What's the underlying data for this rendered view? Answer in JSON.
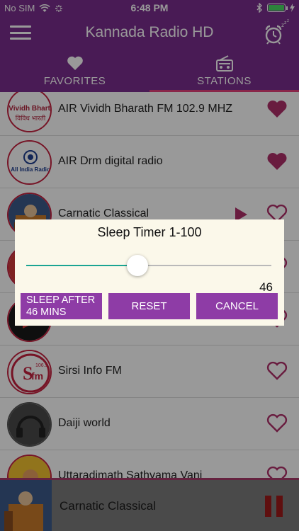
{
  "status_bar": {
    "carrier": "No SIM",
    "time": "6:48 PM"
  },
  "header": {
    "title": "Kannada Radio HD"
  },
  "tabs": [
    {
      "label": "FAVORITES",
      "icon": "heart-icon",
      "active": false
    },
    {
      "label": "STATIONS",
      "icon": "radio-icon",
      "active": true
    }
  ],
  "stations": [
    {
      "name": "AIR Vividh Bharath FM 102.9 MHZ",
      "logo_text": "Vividh Bharti",
      "favorite": true
    },
    {
      "name": "AIR Drm digital radio",
      "logo_text": "All India Radio",
      "favorite": true
    },
    {
      "name": "Carnatic Classical",
      "favorite": false,
      "playing": true
    },
    {
      "name": "",
      "favorite": false
    },
    {
      "name": "",
      "favorite": false
    },
    {
      "name": "Sirsi Info FM",
      "logo_text": "fm",
      "favorite": false
    },
    {
      "name": "Daiji world",
      "favorite": false
    },
    {
      "name": "Uttaradimath Sathyama Vani",
      "favorite": false
    }
  ],
  "dialog": {
    "title": "Sleep Timer 1-100",
    "slider_value": 46,
    "slider_min": 1,
    "slider_max": 100,
    "sleep_button": "SLEEP AFTER 46 MINS",
    "reset_button": "RESET",
    "cancel_button": "CANCEL"
  },
  "player": {
    "now_playing": "Carnatic Classical",
    "state": "playing"
  },
  "colors": {
    "primary": "#7b2e8e",
    "accent": "#e5407a",
    "heart": "#b0306a",
    "dialog_button": "#8e3ca6",
    "slider": "#1aa493",
    "pause": "#9e1a1a"
  }
}
